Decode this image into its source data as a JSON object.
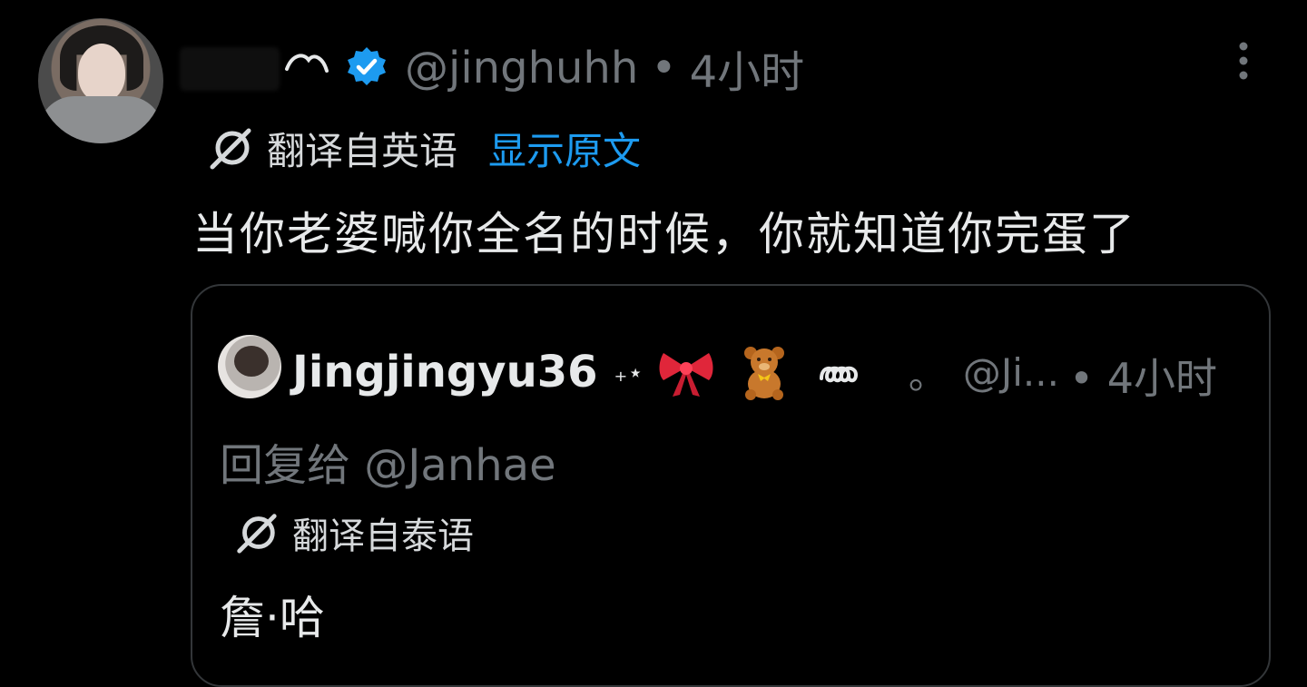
{
  "tweet": {
    "handle": "@jinghuhh",
    "time": "4小时",
    "translated_from": "翻译自英语",
    "show_original": "显示原文",
    "text": "当你老婆喊你全名的时候，你就知道你完蛋了"
  },
  "quoted_tweet": {
    "display_name": "Jingjingyu36",
    "decor_stars": "₊⋆",
    "decor_circle": "。",
    "handle": "@Ji...",
    "time": "• 4小时",
    "reply_to": "回复给 @Janhae",
    "translated_from": "翻译自泰语",
    "text": "詹·哈"
  },
  "icons": {
    "verified": "verified-badge-icon",
    "more": "more-options-icon",
    "translate": "translate-icon",
    "bow": "bow-emoji-icon",
    "bear": "teddy-bear-emoji-icon",
    "swirl": "swirl-decoration-icon"
  },
  "colors": {
    "background": "#000000",
    "text": "#e7e9ea",
    "secondary": "#71767b",
    "link": "#1d9bf0",
    "verified": "#1d9bf0",
    "border": "#333639"
  }
}
